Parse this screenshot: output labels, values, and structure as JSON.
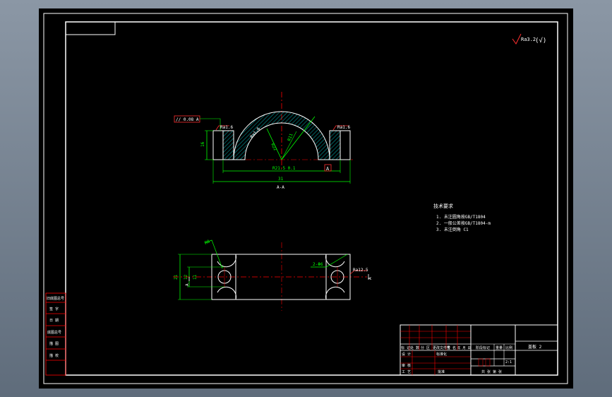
{
  "drawing": {
    "colors": {
      "paper": "#000000",
      "frame": "#ffffff",
      "section_line": "#00ff00",
      "center_line": "#ff0000",
      "dimension": "#00ff00",
      "hatch": "#00e0e0",
      "tolerance_box": "#ff3030",
      "title_grid": "#ff0000"
    },
    "top_view": {
      "parallel_tolerance": "// 0.08 A",
      "roughness_left": "Ra1.6",
      "roughness_right": "Ra1.6",
      "roughness_arc": "Ra1.6",
      "dim_height": "16",
      "dim_radius": "R11",
      "dim_inner": "R21.5 0.1",
      "dim_outer": "31",
      "datum": "A",
      "section_label": "A-A",
      "arc_label_2": "R22"
    },
    "bottom_view": {
      "dim_r": "R8",
      "dim_hole": "2-Φ6",
      "dim_width": "21",
      "dim_inner": "12",
      "dim_small": "11",
      "roughness": "Ra12.5",
      "section_mark": "A",
      "section_mark_2": "A"
    },
    "corner_roughness": "Ra3.2",
    "corner_roughness_symbol": "(√)",
    "tech_notes": {
      "title": "技术要求",
      "items": [
        "1. 未注圆角按GB/T1804",
        "2. 一般公差按GB/T1804-m",
        "3. 未注倒角 C1"
      ]
    },
    "left_labels": [
      "旧底图总号",
      "签 字",
      "日 期",
      "底图总号",
      "描 图",
      "描 校"
    ],
    "title_block": {
      "part_name": "盖板 2",
      "scale": "2:1",
      "designer": "设 计",
      "checker": "审 核",
      "process": "工 艺",
      "approve": "批准",
      "standard": "标准化",
      "mark": "标 记",
      "qty": "处 数",
      "zone": "分 区",
      "doc_no": "更改文件号",
      "sign": "签 名",
      "date": "年 月 日",
      "stage": "阶段标记",
      "weight": "重量",
      "ratio": "比例",
      "sheet": "共 张 第 张"
    }
  }
}
